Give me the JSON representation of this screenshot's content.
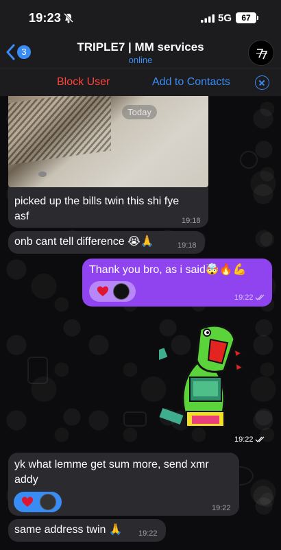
{
  "status_bar": {
    "time": "19:23",
    "network": "5G",
    "battery": "67"
  },
  "header": {
    "back_count": "3",
    "title": "TRIPLE7 | MM services",
    "subtitle": "online"
  },
  "action_bar": {
    "block_label": "Block User",
    "add_label": "Add to Contacts"
  },
  "date_chip": "Today",
  "messages": [
    {
      "direction": "in",
      "text_line1": "picked up the bills twin this shi fye",
      "text_line2": "asf",
      "time": "19:18"
    },
    {
      "direction": "in",
      "text": "onb cant tell difference 😭🙏",
      "time": "19:18"
    },
    {
      "direction": "out",
      "text": "Thank you bro, as i said🤯🔥💪",
      "time": "19:22",
      "reactions": [
        "heart"
      ]
    },
    {
      "direction": "out",
      "type": "sticker",
      "time": "19:22"
    },
    {
      "direction": "in",
      "text_line1": "yk what lemme get sum more, send xmr",
      "text_line2": "addy",
      "time": "19:22",
      "reactions": [
        "heart"
      ]
    },
    {
      "direction": "in",
      "text": "same address twin 🙏",
      "time": "19:22"
    }
  ],
  "colors": {
    "accent": "#3a8cf5",
    "danger": "#ff453a",
    "outgoing_bubble": "#8f44f0",
    "incoming_bubble": "#2b2b2f"
  }
}
